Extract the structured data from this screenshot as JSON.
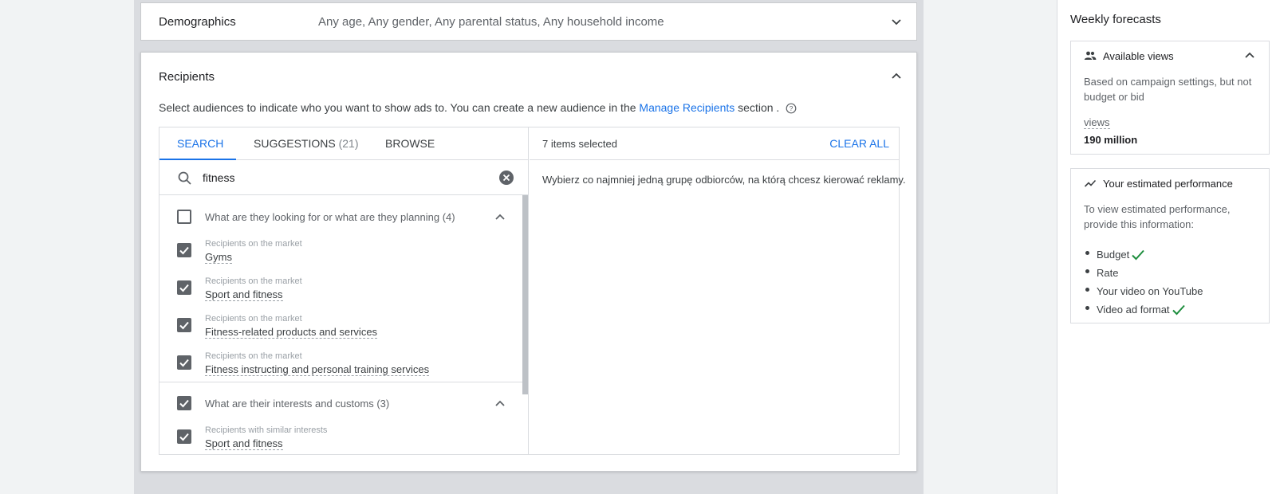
{
  "demographics": {
    "title": "Demographics",
    "value": "Any age, Any gender, Any parental status, Any household income"
  },
  "recipients": {
    "title": "Recipients",
    "description_before": "Select audiences to indicate who you want to show ads to. You can create a new audience in the ",
    "description_link": "Manage Recipients",
    "description_after": " section ."
  },
  "tabs": [
    {
      "label": "SEARCH",
      "active": true
    },
    {
      "label": "SUGGESTIONS",
      "count": "(21)"
    },
    {
      "label": "BROWSE"
    }
  ],
  "search": {
    "value": "fitness",
    "placeholder": ""
  },
  "groups": [
    {
      "label": "What are they looking for or what are they planning (4)",
      "checked": false,
      "items": [
        {
          "category": "Recipients on the market",
          "name": "Gyms"
        },
        {
          "category": "Recipients on the market",
          "name": "Sport and fitness"
        },
        {
          "category": "Recipients on the market",
          "name": "Fitness-related products and services"
        },
        {
          "category": "Recipients on the market",
          "name": "Fitness instructing and personal training services"
        }
      ]
    },
    {
      "label": "What are their interests and customs (3)",
      "checked": true,
      "items": [
        {
          "category": "Recipients with similar interests",
          "name": "Sport and fitness"
        }
      ]
    }
  ],
  "selection": {
    "count_text": "7 items selected",
    "clear_all": "CLEAR ALL",
    "message": "Wybierz co najmniej jedną grupę odbiorców, na którą chcesz kierować reklamy."
  },
  "forecasts": {
    "title": "Weekly forecasts",
    "views_card": {
      "title": "Available views",
      "note": "Based on campaign settings, but not budget or bid",
      "metric_label": "views",
      "metric_value": "190 million"
    },
    "performance_card": {
      "title": "Your estimated performance",
      "note": "To view estimated performance, provide this information:",
      "requirements": [
        {
          "label": "Budget",
          "done": true
        },
        {
          "label": "Rate",
          "done": false
        },
        {
          "label": "Your video on YouTube",
          "done": false
        },
        {
          "label": "Video ad format",
          "done": true
        }
      ]
    }
  },
  "colors": {
    "accent": "#1a73e8",
    "check_green": "#1e8e3e",
    "checkbox": "#5f6368"
  },
  "icons": {
    "expand": "chevron-down-icon",
    "collapse": "chevron-up-icon",
    "search": "search-icon",
    "clear": "clear-icon",
    "help": "help-icon",
    "people": "people-icon",
    "trend": "trending-icon",
    "done": "check-icon"
  }
}
